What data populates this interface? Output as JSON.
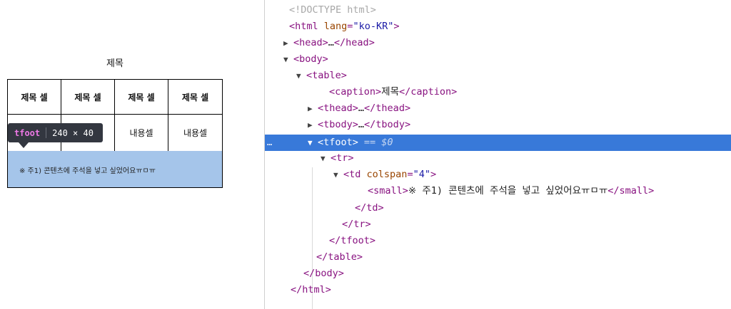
{
  "page": {
    "caption": "제목",
    "headers": [
      "제목 셀",
      "제목 셀",
      "제목 셀",
      "제목 셀"
    ],
    "body_cells": [
      "",
      "",
      "내용셀",
      "내용셀"
    ],
    "tfoot_note": "※ 주1) 콘텐츠에 주석을 넣고 싶었어요ㅠㅁㅠ",
    "tooltip": {
      "tag": "tfoot",
      "size": "240 × 40"
    },
    "highlight_color": "#a5c5ea"
  },
  "devtools": {
    "selection_color": "#3879d9",
    "selected_suffix": "== $0",
    "lines": [
      {
        "tri": "",
        "tag": "<!DOCTYPE html>",
        "kind": "doctype"
      },
      {
        "tri": "",
        "tag": "<html",
        "attr": "lang",
        "val": "\"ko-KR\"",
        "close": ">"
      },
      {
        "tri": "▶",
        "tag": "<head>",
        "text": "…",
        "close": "</head>"
      },
      {
        "tri": "▼",
        "tag": "<body>"
      },
      {
        "tri": "▼",
        "tag": "<table>"
      },
      {
        "tri": "",
        "tag": "<caption>",
        "text": "제목",
        "close": "</caption>"
      },
      {
        "tri": "▶",
        "tag": "<thead>",
        "text": "…",
        "close": "</thead>"
      },
      {
        "tri": "▶",
        "tag": "<tbody>",
        "text": "…",
        "close": "</tbody>"
      },
      {
        "tri": "▼",
        "tag": "<tfoot>",
        "selected": true
      },
      {
        "tri": "▼",
        "tag": "<tr>"
      },
      {
        "tri": "▼",
        "tag": "<td",
        "attr": "colspan",
        "val": "\"4\"",
        "close": ">"
      },
      {
        "tri": "",
        "tag": "<small>",
        "text": "※ 주1) 콘텐츠에 주석을 넣고 싶었어요ㅠㅁㅠ",
        "close": "</small>"
      },
      {
        "tri": "",
        "tag": "</td>"
      },
      {
        "tri": "",
        "tag": "</tr>"
      },
      {
        "tri": "",
        "tag": "</tfoot>"
      },
      {
        "tri": "",
        "tag": "</table>"
      },
      {
        "tri": "",
        "tag": "</body>"
      },
      {
        "tri": "",
        "tag": "</html>"
      }
    ]
  }
}
